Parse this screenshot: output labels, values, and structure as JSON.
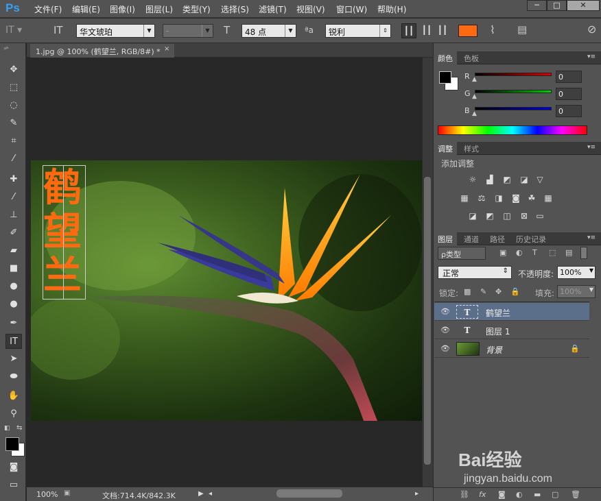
{
  "app": {
    "logo": "Ps"
  },
  "menu": [
    "文件(F)",
    "编辑(E)",
    "图像(I)",
    "图层(L)",
    "类型(Y)",
    "选择(S)",
    "滤镜(T)",
    "视图(V)",
    "窗口(W)",
    "帮助(H)"
  ],
  "window_buttons": {
    "minimize": "─",
    "maximize": "□",
    "close": "✕"
  },
  "options": {
    "font_family": "华文琥珀",
    "font_style": "-",
    "font_size": "48 点",
    "aa_label": "ªa",
    "antialias": "锐利",
    "color": "#ff6a10"
  },
  "document": {
    "tab_title": "1.jpg @ 100% (鹤望兰, RGB/8#) *",
    "tab_close": "×"
  },
  "canvas": {
    "text_lines": [
      "鹤",
      "望",
      "兰"
    ],
    "text_color": "#ff6a10"
  },
  "status": {
    "zoom": "100%",
    "doc_info": "文档:714.4K/842.3K"
  },
  "color_panel": {
    "tabs": [
      "颜色",
      "色板"
    ],
    "r_label": "R",
    "g_label": "G",
    "b_label": "B",
    "r": "0",
    "g": "0",
    "b": "0"
  },
  "adjust_panel": {
    "tabs": [
      "调整",
      "样式"
    ],
    "title": "添加调整"
  },
  "layers_panel": {
    "tabs": [
      "图层",
      "通道",
      "路径",
      "历史记录"
    ],
    "filter": "ρ类型",
    "blend_mode": "正常",
    "opacity_label": "不透明度:",
    "opacity": "100%",
    "lock_label": "锁定:",
    "fill_label": "填充:",
    "fill": "100%",
    "layers": [
      {
        "name": "鹤望兰",
        "type": "T",
        "selected": true
      },
      {
        "name": "图层 1",
        "type": "T",
        "selected": false
      },
      {
        "name": "背景",
        "type": "image",
        "selected": false
      }
    ]
  },
  "watermark": {
    "brand": "Bai经验",
    "url": "jingyan.baidu.com"
  }
}
